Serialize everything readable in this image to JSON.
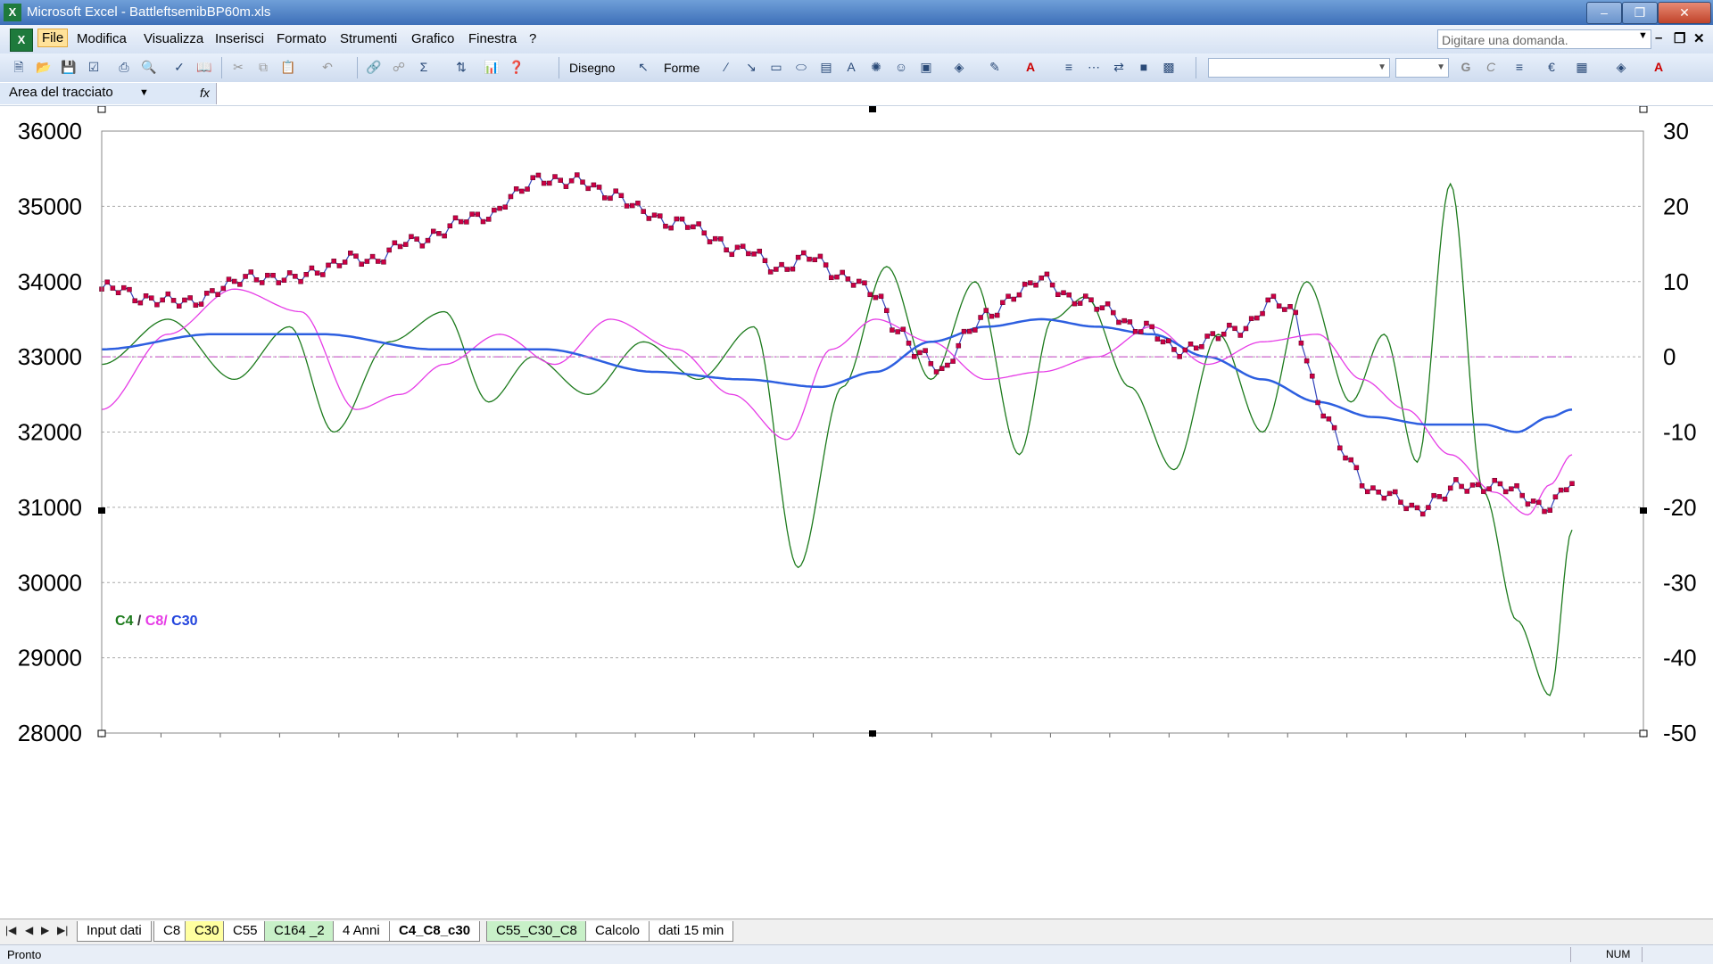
{
  "window": {
    "title": "Microsoft Excel - BattleftsemibBP60m.xls",
    "app_icon": "excel-icon"
  },
  "menu": {
    "items": [
      "File",
      "Modifica",
      "Visualizza",
      "Inserisci",
      "Formato",
      "Strumenti",
      "Grafico",
      "Finestra",
      "?"
    ],
    "active": "File",
    "ask_placeholder": "Digitare una domanda."
  },
  "toolbar": {
    "drawing_label": "Disegno",
    "shapes_label": "Forme"
  },
  "namebox": {
    "value": "Area del tracciato",
    "fx_label": "fx"
  },
  "chart_data": {
    "type": "line",
    "legend": {
      "c4": "C4",
      "sep1": " / ",
      "c8": "C8/",
      "c30": " C30",
      "colors": {
        "c4": "#1c7a1c",
        "c8": "#e63ce6",
        "c30": "#2244dd"
      }
    },
    "y_left": {
      "min": 28000,
      "max": 36000,
      "ticks": [
        "36000",
        "35000",
        "34000",
        "33000",
        "32000",
        "31000",
        "30000",
        "29000",
        "28000"
      ]
    },
    "y_right": {
      "min": -50,
      "max": 30,
      "ticks": [
        "30",
        "20",
        "10",
        "0",
        "-10",
        "-20",
        "-30",
        "-40",
        "-50"
      ]
    },
    "x_count": 266,
    "grid": true,
    "series": [
      {
        "key": "price",
        "axis": "left",
        "color": "#3344bb",
        "marker_color": "#cc0044",
        "x": [
          0,
          8,
          14,
          22,
          28,
          34,
          40,
          48,
          56,
          62,
          66,
          70,
          74,
          80,
          86,
          92,
          98,
          104,
          110,
          116,
          122,
          128,
          134,
          140,
          144,
          148,
          152,
          156,
          160,
          166,
          170,
          176,
          182,
          188,
          194,
          200,
          206,
          212,
          216,
          218,
          220,
          222,
          224,
          226,
          230,
          234,
          238,
          242,
          246,
          250,
          256,
          262,
          266
        ],
        "values": [
          33900,
          33800,
          33700,
          33900,
          34100,
          34000,
          34200,
          34300,
          34500,
          34700,
          34800,
          34900,
          35100,
          35400,
          35300,
          35200,
          34900,
          34800,
          34600,
          34400,
          34200,
          34300,
          34100,
          33800,
          33400,
          33000,
          32800,
          33300,
          33500,
          33900,
          34000,
          33800,
          33600,
          33400,
          33100,
          33200,
          33400,
          33700,
          33600,
          33000,
          32400,
          32100,
          31800,
          31600,
          31200,
          31100,
          31000,
          31100,
          31300,
          31300,
          31200,
          31000,
          31300
        ]
      },
      {
        "key": "c4",
        "axis": "right",
        "color": "#1c7a1c",
        "x": [
          0,
          12,
          24,
          34,
          42,
          52,
          62,
          70,
          78,
          88,
          98,
          108,
          118,
          126,
          134,
          142,
          150,
          158,
          166,
          172,
          178,
          186,
          194,
          202,
          210,
          218,
          226,
          232,
          238,
          244,
          250,
          256,
          262,
          266
        ],
        "values": [
          -1,
          5,
          -3,
          4,
          -10,
          2,
          6,
          -6,
          0,
          -5,
          2,
          -3,
          4,
          -28,
          -4,
          12,
          -3,
          10,
          -13,
          5,
          8,
          -4,
          -15,
          3,
          -10,
          10,
          -6,
          3,
          -14,
          23,
          -18,
          -35,
          -45,
          -23
        ]
      },
      {
        "key": "c8",
        "axis": "right",
        "color": "#e63ce6",
        "x": [
          0,
          12,
          24,
          36,
          46,
          54,
          62,
          72,
          82,
          92,
          104,
          114,
          124,
          132,
          140,
          150,
          160,
          170,
          180,
          190,
          200,
          210,
          220,
          228,
          236,
          244,
          252,
          258,
          262,
          266
        ],
        "values": [
          -7,
          3,
          9,
          6,
          -7,
          -5,
          -1,
          3,
          -1,
          5,
          1,
          -5,
          -11,
          1,
          5,
          2,
          -3,
          -2,
          0,
          4,
          -1,
          2,
          3,
          -3,
          -7,
          -13,
          -18,
          -21,
          -17,
          -13
        ]
      },
      {
        "key": "c30",
        "axis": "right",
        "color": "#2d5fe0",
        "x": [
          0,
          20,
          40,
          60,
          80,
          100,
          116,
          130,
          140,
          150,
          160,
          170,
          180,
          190,
          200,
          210,
          220,
          230,
          240,
          250,
          256,
          262,
          266
        ],
        "values": [
          1,
          3,
          3,
          1,
          1,
          -2,
          -3,
          -4,
          -2,
          2,
          4,
          5,
          4,
          3,
          0,
          -3,
          -6,
          -8,
          -9,
          -9,
          -10,
          -8,
          -7
        ]
      },
      {
        "key": "zero",
        "axis": "right",
        "color": "#cc66cc",
        "dashed": true,
        "x": [
          0,
          266
        ],
        "values": [
          0,
          0
        ]
      }
    ]
  },
  "sheets": {
    "tabs": [
      "Input dati",
      "C8",
      "C30",
      "C55",
      "C164 _2",
      "4 Anni",
      "C4_C8_c30",
      "C55_C30_C8",
      "Calcolo",
      "dati 15 min"
    ],
    "active": "C4_C8_c30",
    "colors": {
      "C30": "#ffffa0",
      "C164 _2": "#c8f0c8",
      "C55_C30_C8": "#c8f0c8"
    }
  },
  "status": {
    "left": "Pronto",
    "num": "NUM"
  }
}
